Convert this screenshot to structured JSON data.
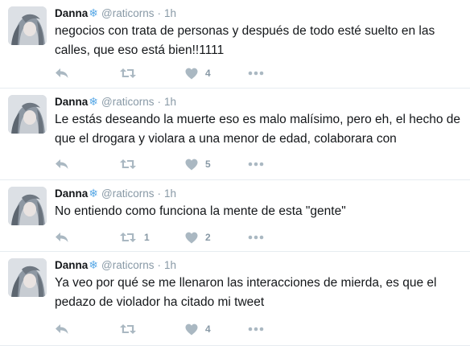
{
  "colors": {
    "icon": "#aab8c2",
    "meta": "#8899a6",
    "text": "#14171a",
    "divider": "#e6ecf0",
    "flake": "#5aa9e6"
  },
  "tweets": [
    {
      "name": "Danna",
      "emoji": "❄",
      "handle": "@raticorns",
      "dot": "·",
      "time": "1h",
      "text": "negocios con trata de personas y después de todo esté suelto en las calles, que eso está bien!!1111",
      "retweets": "",
      "likes": "4"
    },
    {
      "name": "Danna",
      "emoji": "❄",
      "handle": "@raticorns",
      "dot": "·",
      "time": "1h",
      "text": "Le estás deseando la muerte eso es malo malísimo, pero eh, el hecho de que el drogara y violara a una menor de edad, colaborara con",
      "retweets": "",
      "likes": "5"
    },
    {
      "name": "Danna",
      "emoji": "❄",
      "handle": "@raticorns",
      "dot": "·",
      "time": "1h",
      "text": "No entiendo como funciona la mente de esta \"gente\"",
      "retweets": "1",
      "likes": "2"
    },
    {
      "name": "Danna",
      "emoji": "❄",
      "handle": "@raticorns",
      "dot": "·",
      "time": "1h",
      "text": "Ya veo por qué se me llenaron las interacciones de mierda, es que el pedazo de violador ha citado mi tweet",
      "retweets": "",
      "likes": "4"
    }
  ]
}
